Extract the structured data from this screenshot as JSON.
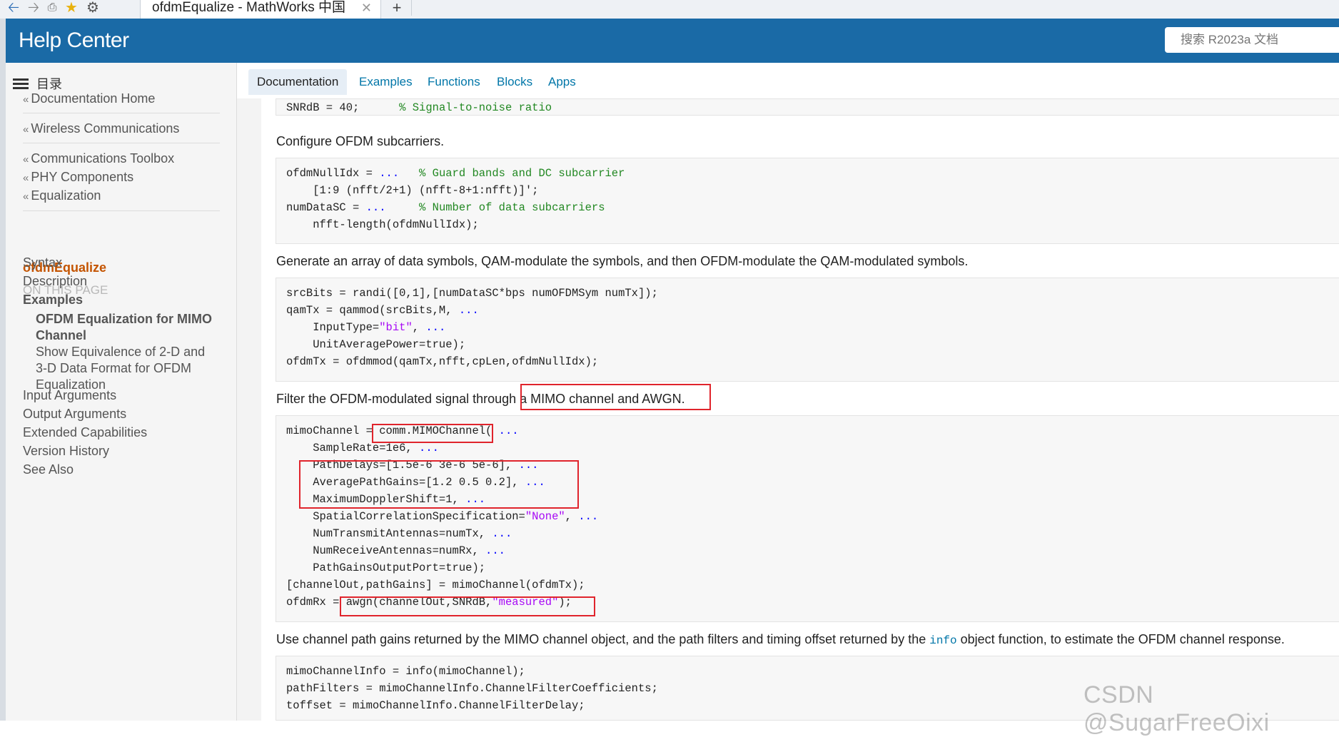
{
  "browser": {
    "tab_title": "ofdmEqualize - MathWorks 中国",
    "tab_close": "✕",
    "new_tab": "+"
  },
  "header": {
    "brand": "Help Center",
    "search_placeholder": "搜索 R2023a 文档"
  },
  "sidebar": {
    "toc_label": "目录",
    "crumbs": [
      "Documentation Home",
      "Wireless Communications",
      "Communications Toolbox",
      "PHY Components",
      "Equalization"
    ],
    "current": "ofdmEqualize",
    "on_this_page": "ON THIS PAGE",
    "links": [
      "Syntax",
      "Description",
      "Examples"
    ],
    "examples": [
      "OFDM Equalization for MIMO Channel",
      "Show Equivalence of 2-D and 3-D Data Format for OFDM Equalization"
    ],
    "more_links": [
      "Input Arguments",
      "Output Arguments",
      "Extended Capabilities",
      "Version History",
      "See Also"
    ]
  },
  "tabs": [
    "Documentation",
    "Examples",
    "Functions",
    "Blocks",
    "Apps"
  ],
  "content": {
    "snr_code": "SNRdB = 40;",
    "snr_comment": "% Signal-to-noise ratio",
    "p1": "Configure OFDM subcarriers.",
    "code1": {
      "l1a": "ofdmNullIdx = ",
      "l1e": "...",
      "l1c": "% Guard bands and DC subcarrier",
      "l2": "    [1:9 (nfft/2+1) (nfft-8+1:nfft)]';",
      "l3a": "numDataSC = ",
      "l3e": "...",
      "l3c": "% Number of data subcarriers",
      "l4": "    nfft-length(ofdmNullIdx);"
    },
    "p2": "Generate an array of data symbols, QAM-modulate the symbols, and then OFDM-modulate the QAM-modulated symbols.",
    "code2": {
      "l1": "srcBits = randi([0,1],[numDataSC*bps numOFDMSym numTx]);",
      "l2a": "qamTx = qammod(srcBits,M, ",
      "l2e": "...",
      "l3a": "    InputType=",
      "l3s": "\"bit\"",
      "l3b": ", ",
      "l3e": "...",
      "l4": "    UnitAveragePower=true);",
      "l5": "ofdmTx = ofdmmod(qamTx,nfft,cpLen,ofdmNullIdx);"
    },
    "p3": "Filter the OFDM-modulated signal through a MIMO channel and AWGN.",
    "code3": {
      "l1a": "mimoChannel = comm.MIMOChannel( ",
      "l1e": "...",
      "l2a": "    SampleRate=1e6, ",
      "l2e": "...",
      "l3a": "    PathDelays=[1.5e-6 3e-6 5e-6], ",
      "l3e": "...",
      "l4a": "    AveragePathGains=[1.2 0.5 0.2], ",
      "l4e": "...",
      "l5a": "    MaximumDopplerShift=1, ",
      "l5e": "...",
      "l6a": "    SpatialCorrelationSpecification=",
      "l6s": "\"None\"",
      "l6b": ", ",
      "l6e": "...",
      "l7a": "    NumTransmitAntennas=numTx, ",
      "l7e": "...",
      "l8a": "    NumReceiveAntennas=numRx, ",
      "l8e": "...",
      "l9": "    PathGainsOutputPort=true);",
      "l10": "[channelOut,pathGains] = mimoChannel(ofdmTx);",
      "l11a": "ofdmRx = awgn(channelOut,SNRdB,",
      "l11s": "\"measured\"",
      "l11b": ");"
    },
    "p4a": "Use channel path gains returned by the MIMO channel object, and the path filters and timing offset returned by the ",
    "p4code": "info",
    "p4b": " object function, to estimate the OFDM channel response.",
    "code4": {
      "l1": "mimoChannelInfo = info(mimoChannel);",
      "l2": "pathFilters = mimoChannelInfo.ChannelFilterCoefficients;",
      "l3": "toffset = mimoChannelInfo.ChannelFilterDelay;"
    }
  },
  "watermark": "CSDN @SugarFreeOixi",
  "colors": {
    "header": "#1a6aa6",
    "link": "#0076a8",
    "current_page": "#c45400",
    "comment": "#228822",
    "string": "#a709f5",
    "ellipsis": "#0000ff",
    "annotation": "#e0242c"
  }
}
